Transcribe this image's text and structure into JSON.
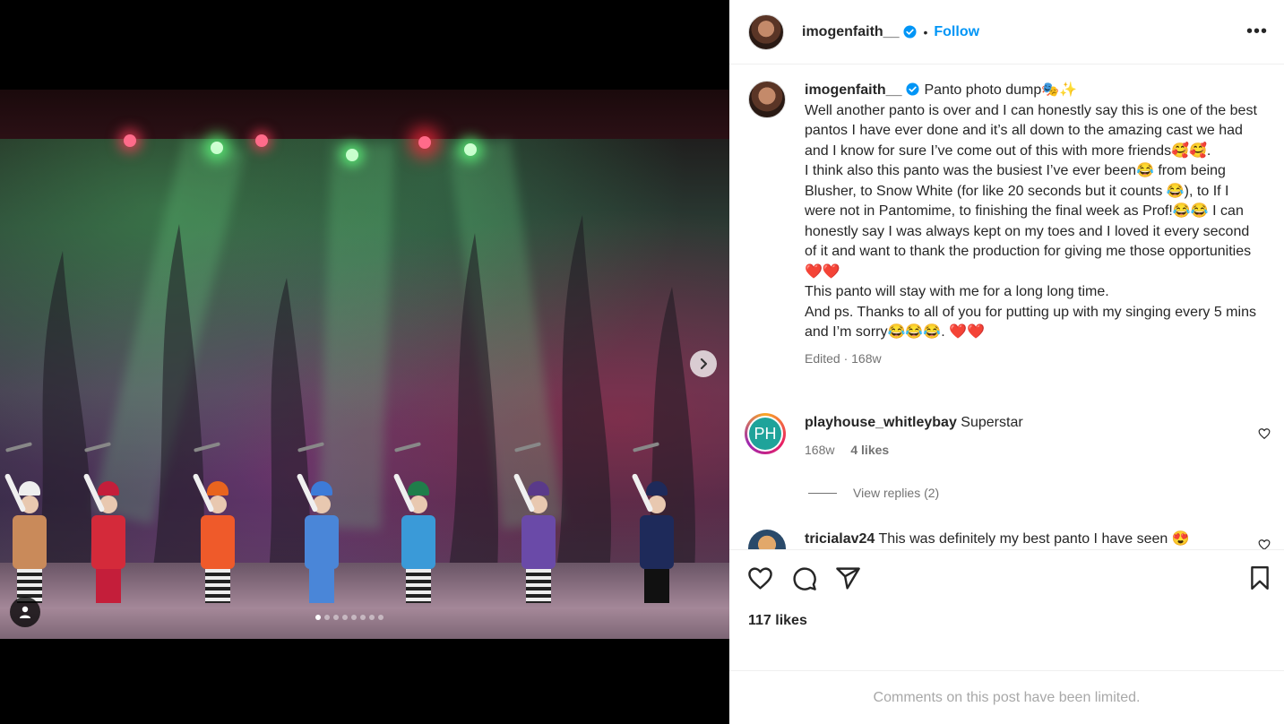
{
  "post": {
    "username": "imogenfaith__",
    "follow_label": "Follow",
    "separator": "•",
    "more_label": "•••",
    "caption_lines": [
      "Panto photo dump🎭✨",
      "Well another panto is over and I can honestly say this is one of the best pantos I have ever done and it’s all down to the amazing cast we had and I know for sure I’ve come out of this with more friends🥰🥰.",
      "I think also this panto was the busiest I’ve ever been😂 from being Blusher, to Snow White (for like 20 seconds but it counts 😂), to If I were not in Pantomime, to finishing the final week as Prof!😂😂 I can honestly say I was always kept on my toes and I loved it every second of it and want to thank the production for giving me those opportunities❤️❤️",
      "This panto will stay with me for a long long time.",
      "And ps. Thanks to all of you for putting up with my singing every 5 mins and I’m sorry😂😂😂. ❤️❤️"
    ],
    "caption_meta": "Edited · 168w",
    "likes": "117 likes",
    "comments_limited": "Comments on this post have been limited."
  },
  "comments": [
    {
      "avatar_initials": "PH",
      "username": "playhouse_whitleybay",
      "text": "Superstar",
      "age": "168w",
      "likes": "4 likes",
      "replies": "View replies (2)"
    },
    {
      "username": "tricialav24",
      "text": "This was definitely my best panto I have seen 😍"
    }
  ],
  "carousel": {
    "count": 8,
    "active_index": 0
  },
  "icons": {
    "verified": "verified-badge-icon",
    "next": "chevron-right-icon",
    "user_tag": "user-tag-icon",
    "like": "heart-icon",
    "comment": "comment-icon",
    "share": "share-icon",
    "save": "bookmark-icon"
  },
  "colors": {
    "accent": "#0095f6",
    "verified": "#0095f6",
    "muted": "#737373",
    "limited_text": "#a8a8a8"
  }
}
